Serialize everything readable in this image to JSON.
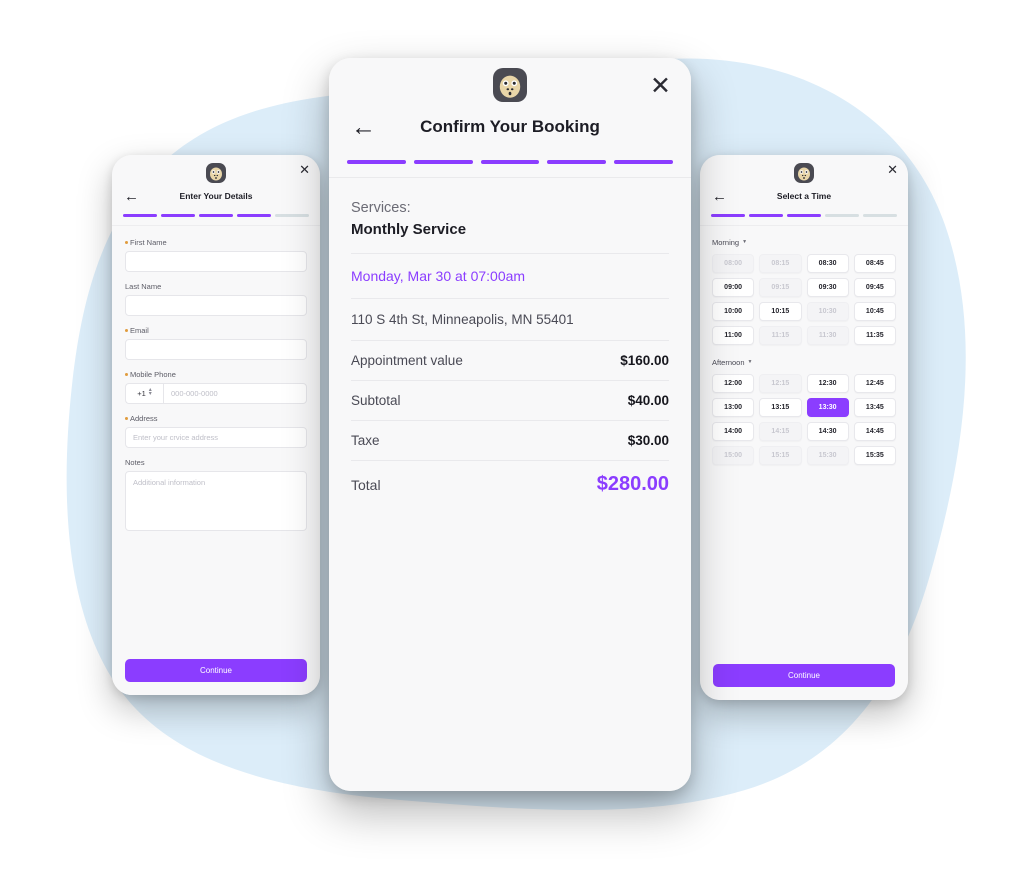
{
  "theme": {
    "accent": "#8B3DFF",
    "blob": "#DCEDF9",
    "panel_bg": "#F8F8F9",
    "required_dot": "#E09B3D"
  },
  "icons": {
    "logo": "gorilla-logo",
    "close": "✕",
    "back": "←",
    "caret_down": "▼",
    "stepper": "⌃⌄"
  },
  "left_panel": {
    "title": "Enter Your Details",
    "progress_total": 5,
    "progress_filled": 4,
    "fields": [
      {
        "label": "First Name",
        "required": true,
        "value": "",
        "placeholder": ""
      },
      {
        "label": "Last Name",
        "required": false,
        "value": "",
        "placeholder": ""
      },
      {
        "label": "Email",
        "required": true,
        "value": "",
        "placeholder": ""
      }
    ],
    "phone": {
      "label": "Mobile Phone",
      "required": true,
      "country_code": "+1",
      "placeholder": "000-000-0000",
      "value": ""
    },
    "address": {
      "label": "Address",
      "required": true,
      "placeholder": "Enter your crvice address",
      "value": ""
    },
    "notes": {
      "label": "Notes",
      "required": false,
      "placeholder": "Additional information",
      "value": ""
    },
    "continue_label": "Continue"
  },
  "center_panel": {
    "title": "Confirm Your Booking",
    "progress_total": 5,
    "progress_filled": 5,
    "services_label": "Services:",
    "service_name": "Monthly Service",
    "datetime": "Monday, Mar 30 at 07:00am",
    "address": "110 S 4th St, Minneapolis, MN 55401",
    "rows": [
      {
        "label": "Appointment value",
        "value": "$160.00"
      },
      {
        "label": "Subtotal",
        "value": "$40.00"
      },
      {
        "label": "Taxe",
        "value": "$30.00"
      }
    ],
    "total_label": "Total",
    "total_value": "$280.00"
  },
  "right_panel": {
    "title": "Select a Time",
    "progress_total": 5,
    "progress_filled": 3,
    "sections": [
      {
        "name": "Morning",
        "slots": [
          {
            "time": "08:00",
            "state": "disabled"
          },
          {
            "time": "08:15",
            "state": "disabled"
          },
          {
            "time": "08:30",
            "state": "available"
          },
          {
            "time": "08:45",
            "state": "available"
          },
          {
            "time": "09:00",
            "state": "available"
          },
          {
            "time": "09:15",
            "state": "disabled"
          },
          {
            "time": "09:30",
            "state": "available"
          },
          {
            "time": "09:45",
            "state": "available"
          },
          {
            "time": "10:00",
            "state": "available"
          },
          {
            "time": "10:15",
            "state": "available"
          },
          {
            "time": "10:30",
            "state": "disabled"
          },
          {
            "time": "10:45",
            "state": "available"
          },
          {
            "time": "11:00",
            "state": "available"
          },
          {
            "time": "11:15",
            "state": "disabled"
          },
          {
            "time": "11:30",
            "state": "disabled"
          },
          {
            "time": "11:35",
            "state": "available"
          }
        ]
      },
      {
        "name": "Afternoon",
        "slots": [
          {
            "time": "12:00",
            "state": "available"
          },
          {
            "time": "12:15",
            "state": "disabled"
          },
          {
            "time": "12:30",
            "state": "available"
          },
          {
            "time": "12:45",
            "state": "available"
          },
          {
            "time": "13:00",
            "state": "available"
          },
          {
            "time": "13:15",
            "state": "available"
          },
          {
            "time": "13:30",
            "state": "selected"
          },
          {
            "time": "13:45",
            "state": "available"
          },
          {
            "time": "14:00",
            "state": "available"
          },
          {
            "time": "14:15",
            "state": "disabled"
          },
          {
            "time": "14:30",
            "state": "available"
          },
          {
            "time": "14:45",
            "state": "available"
          },
          {
            "time": "15:00",
            "state": "disabled"
          },
          {
            "time": "15:15",
            "state": "disabled"
          },
          {
            "time": "15:30",
            "state": "disabled"
          },
          {
            "time": "15:35",
            "state": "available"
          }
        ]
      }
    ],
    "continue_label": "Continue"
  }
}
